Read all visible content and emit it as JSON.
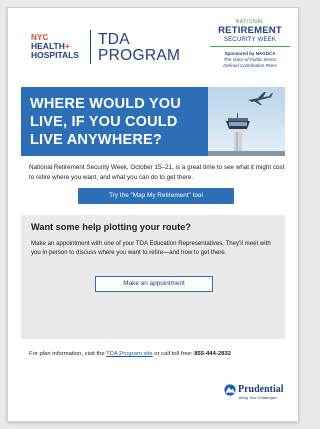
{
  "header": {
    "nyc_logo": {
      "line1": "NYC",
      "line2": "HEALTH",
      "plus": "+",
      "line3": "HOSPITALS"
    },
    "program_title": {
      "line1": "TDA",
      "line2": "PROGRAM"
    },
    "nrsw_badge": {
      "national": "NATIONAL",
      "retirement": "RETIREMENT",
      "security_week": "SECURITY WEEK",
      "sponsored": "Sponsored by NAGDCA",
      "voice_line1": "The Voice of Public Sector",
      "voice_line2": "Defined Contribution Plans"
    }
  },
  "hero": {
    "line1": "WHERE WOULD YOU",
    "line2": "LIVE, IF YOU COULD",
    "line3": "LIVE ANYWHERE?",
    "photo_icon": "airport-tower-airplane-photo"
  },
  "intro": {
    "text": "National Retirement Security Week, October 15–21, is a great time to see what it might cost to retire where you want, and what you can do to get there."
  },
  "primary_button": {
    "label": "Try the \"Map My Retirement\" tool"
  },
  "panel": {
    "title": "Want some help plotting your route?",
    "body": "Make an appointment with one of your TDA Education Representatives. They'll meet with you in person to discuss where you want to retire—and how to get there.",
    "button_label": "Make an appointment"
  },
  "footer": {
    "prefix": "For plan information, visit the ",
    "link_text": "TDA Program site",
    "middle": " or call toll free: ",
    "phone": "855-444-2832"
  },
  "prudential": {
    "name": "Prudential",
    "tagline": "Bring Your Challenges"
  },
  "colors": {
    "brand_blue": "#2d6fb6",
    "navy": "#1e3f86",
    "nyc_red": "#e8442c",
    "nrsw_green": "#4aa04f",
    "panel_gray": "#eaeaea"
  }
}
